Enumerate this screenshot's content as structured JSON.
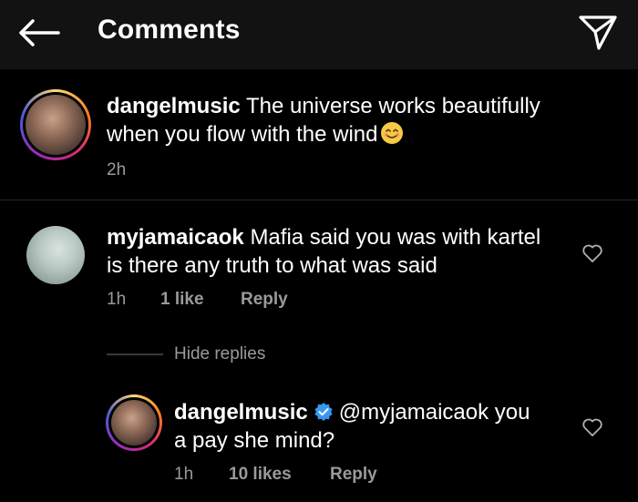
{
  "header": {
    "title": "Comments"
  },
  "caption": {
    "username": "dangelmusic",
    "text": "The universe works beautifully",
    "text_line2": "when you flow with the wind",
    "time": "2h"
  },
  "comment": {
    "username": "myjamaicaok",
    "text": "Mafia said you was with kartel",
    "text_line2": "is there any truth to what was said",
    "time": "1h",
    "likes": "1 like",
    "reply_label": "Reply"
  },
  "hide_replies_label": "Hide replies",
  "reply": {
    "username": "dangelmusic",
    "mention": "@myjamaicaok you",
    "text_line2": "a pay she mind?",
    "time": "1h",
    "likes": "10 likes",
    "reply_label": "Reply"
  },
  "colors": {
    "header_bg": "#121212",
    "meta_text": "#9a9a9a",
    "verified": "#3897f0"
  }
}
